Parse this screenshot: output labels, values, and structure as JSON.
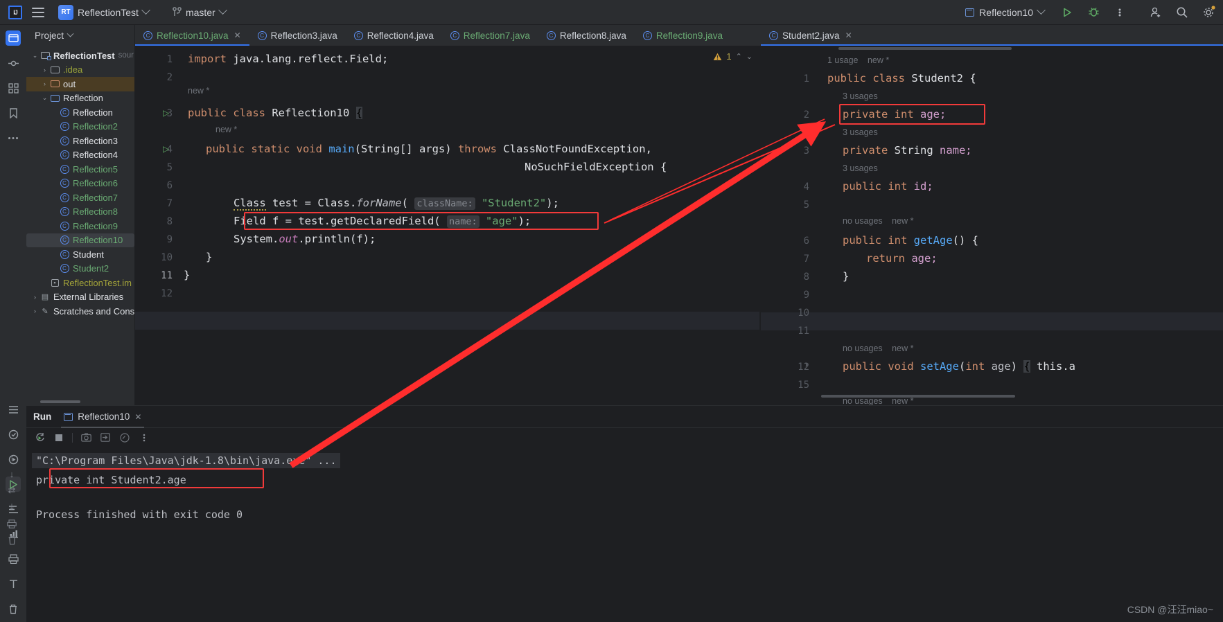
{
  "titlebar": {
    "logo": "IJ",
    "menu_icon": "hamburger-icon",
    "project_badge": "RT",
    "project_name": "ReflectionTest",
    "branch_icon": "git-branch-icon",
    "branch_name": "master",
    "run_config": "Reflection10",
    "run_icon": "run-icon",
    "debug_icon": "debug-icon",
    "more_icon": "more-vertical-icon",
    "add_user_icon": "add-user-icon",
    "search_icon": "search-icon",
    "settings_icon": "settings-icon"
  },
  "rail": {
    "items": [
      {
        "name": "project-tool-icon",
        "glyph": "▭"
      },
      {
        "name": "commit-tool-icon",
        "glyph": "⎇"
      },
      {
        "name": "structure-tool-icon",
        "glyph": "⌘"
      },
      {
        "name": "bookmarks-tool-icon",
        "glyph": "🔖"
      },
      {
        "name": "more-tool-icon",
        "glyph": "⋯"
      }
    ],
    "bottom_items": [
      {
        "name": "todo-tool-icon",
        "glyph": "☰"
      },
      {
        "name": "problems-tool-icon",
        "glyph": "◎"
      },
      {
        "name": "services-tool-icon",
        "glyph": "▶"
      },
      {
        "name": "run-tool-icon",
        "glyph": "▷"
      },
      {
        "name": "debug-console-icon",
        "glyph": "⇶"
      },
      {
        "name": "profiler-icon",
        "glyph": "📊"
      },
      {
        "name": "print-icon",
        "glyph": "🖨"
      },
      {
        "name": "terminal-tool-icon",
        "glyph": "T"
      },
      {
        "name": "delete-icon",
        "glyph": "🗑"
      }
    ]
  },
  "project_panel": {
    "title": "Project",
    "chevron": "chevron-down-icon",
    "tree": [
      {
        "depth": 0,
        "arrow": "v",
        "icon": "module-folder",
        "label": "ReflectionTest",
        "suffix": "sour",
        "style": "bold-white"
      },
      {
        "depth": 1,
        "arrow": ">",
        "icon": "folder-grey",
        "label": ".idea",
        "suffix": "",
        "style": "olive"
      },
      {
        "depth": 1,
        "arrow": ">",
        "icon": "folder-orange",
        "label": "out",
        "suffix": "",
        "style": "white",
        "selected": "out"
      },
      {
        "depth": 1,
        "arrow": "v",
        "icon": "folder-blue",
        "label": "Reflection",
        "suffix": "",
        "style": "white"
      },
      {
        "depth": 2,
        "arrow": "",
        "icon": "class",
        "label": "Reflection",
        "suffix": "",
        "style": "white"
      },
      {
        "depth": 2,
        "arrow": "",
        "icon": "class",
        "label": "Reflection2",
        "suffix": "",
        "style": "green"
      },
      {
        "depth": 2,
        "arrow": "",
        "icon": "class",
        "label": "Reflection3",
        "suffix": "",
        "style": "white"
      },
      {
        "depth": 2,
        "arrow": "",
        "icon": "class",
        "label": "Reflection4",
        "suffix": "",
        "style": "white"
      },
      {
        "depth": 2,
        "arrow": "",
        "icon": "class",
        "label": "Reflection5",
        "suffix": "",
        "style": "green"
      },
      {
        "depth": 2,
        "arrow": "",
        "icon": "class",
        "label": "Reflection6",
        "suffix": "",
        "style": "green"
      },
      {
        "depth": 2,
        "arrow": "",
        "icon": "class",
        "label": "Reflection7",
        "suffix": "",
        "style": "green"
      },
      {
        "depth": 2,
        "arrow": "",
        "icon": "class",
        "label": "Reflection8",
        "suffix": "",
        "style": "green"
      },
      {
        "depth": 2,
        "arrow": "",
        "icon": "class",
        "label": "Reflection9",
        "suffix": "",
        "style": "green"
      },
      {
        "depth": 2,
        "arrow": "",
        "icon": "class",
        "label": "Reflection10",
        "suffix": "",
        "style": "green",
        "selected": "file"
      },
      {
        "depth": 2,
        "arrow": "",
        "icon": "class",
        "label": "Student",
        "suffix": "",
        "style": "white"
      },
      {
        "depth": 2,
        "arrow": "",
        "icon": "class",
        "label": "Student2",
        "suffix": "",
        "style": "green"
      },
      {
        "depth": 1,
        "arrow": "",
        "icon": "iml",
        "label": "ReflectionTest.im",
        "suffix": "",
        "style": "yellow"
      },
      {
        "depth": 0,
        "arrow": ">",
        "icon": "library",
        "label": "External Libraries",
        "suffix": "",
        "style": "white"
      },
      {
        "depth": 0,
        "arrow": ">",
        "icon": "scratch",
        "label": "Scratches and Cons",
        "suffix": "",
        "style": "white"
      }
    ]
  },
  "editor_tabs": [
    {
      "label": "Reflection10.java",
      "active": true,
      "color": "green",
      "closable": true
    },
    {
      "label": "Reflection3.java",
      "active": false,
      "color": "white",
      "closable": false
    },
    {
      "label": "Reflection4.java",
      "active": false,
      "color": "white",
      "closable": false
    },
    {
      "label": "Reflection7.java",
      "active": false,
      "color": "green",
      "closable": false
    },
    {
      "label": "Reflection8.java",
      "active": false,
      "color": "white",
      "closable": false
    },
    {
      "label": "Reflection9.java",
      "active": false,
      "color": "green",
      "closable": false
    }
  ],
  "tabbar_overflow": "chevron-down-icon",
  "tabbar_more": "more-vertical-icon",
  "right_tab": {
    "label": "Student2.java",
    "color": "white",
    "closable": true
  },
  "left_editor": {
    "warning_count": "1",
    "warning_icon": "warning-triangle-icon",
    "up_icon": "chevron-up-icon",
    "down_icon": "chevron-down-icon",
    "line_numbers": [
      "1",
      "2",
      "3",
      "4",
      "5",
      "6",
      "7",
      "8",
      "9",
      "10",
      "11",
      "12"
    ],
    "current_line": "11",
    "inlay_hints": [
      "new *",
      "new *"
    ],
    "code": {
      "l1": "import java.lang.reflect.Field;",
      "l3": "public class Reflection10 {",
      "l4a": "public static void main(String[] args) throws ClassNotFoundException,",
      "l5": "NoSuchFieldException {",
      "l7": "Class test = Class.forName( className: \"Student2\");",
      "l7_parts": {
        "t1": "Class",
        "t2": " test = Class.",
        "t3": "forName",
        "t4": "( ",
        "hint": "className:",
        "str": "\"Student2\"",
        "t5": ");"
      },
      "l8": "Field f = test.getDeclaredField( name: \"age\");",
      "l8_parts": {
        "t1": "Field",
        "t2": " f = test.getDeclaredField",
        "t3": "( ",
        "hint": "name:",
        "str": "\"age\"",
        "t4": ");"
      },
      "l9": "System.out.println(f);",
      "l10": "}",
      "l11": "}"
    }
  },
  "right_editor": {
    "line_numbers": [
      "1",
      "2",
      "3",
      "4",
      "5",
      "6",
      "7",
      "8",
      "9",
      "10",
      "11",
      "12",
      "15"
    ],
    "lines": [
      {
        "usage": "1 usage",
        "new": "new *",
        "code": "public class Student2 {",
        "num": "1"
      },
      {
        "usage": "3 usages",
        "new": "",
        "code": "private int age;",
        "num": "2",
        "boxed": true
      },
      {
        "usage": "3 usages",
        "new": "",
        "code": "private String name;",
        "num": "3"
      },
      {
        "usage": "3 usages",
        "new": "",
        "code": "public int id;",
        "num": "4"
      },
      {
        "usage": "",
        "new": "",
        "code": "",
        "num": "5"
      },
      {
        "usage": "no usages",
        "new": "new *",
        "code": "public int getAge() {",
        "num": "6"
      },
      {
        "usage": "",
        "new": "",
        "code": "return age;",
        "num": "7"
      },
      {
        "usage": "",
        "new": "",
        "code": "}",
        "num": "8"
      },
      {
        "usage": "",
        "new": "",
        "code": "",
        "num": "9"
      },
      {
        "usage": "",
        "new": "",
        "code": "",
        "num": "10"
      },
      {
        "usage": "",
        "new": "",
        "code": "",
        "num": "11"
      },
      {
        "usage": "no usages",
        "new": "new *",
        "code": "public void setAge(int age) { this.a",
        "num": "12"
      },
      {
        "usage": "no usages",
        "new": "new *",
        "code": "",
        "num": "15"
      }
    ]
  },
  "run_window": {
    "title": "Run",
    "tab_label": "Reflection10",
    "tab_icon": "run-config-icon",
    "close_icon": "close-icon",
    "toolbar": [
      {
        "name": "rerun-icon",
        "glyph": "⟳"
      },
      {
        "name": "stop-icon",
        "glyph": "■"
      },
      {
        "name": "screenshot-icon",
        "glyph": "⎙"
      },
      {
        "name": "export-icon",
        "glyph": "⇥"
      },
      {
        "name": "soft-wrap-icon",
        "glyph": "⊘"
      },
      {
        "name": "more-vertical-icon",
        "glyph": "⋮"
      }
    ],
    "side_icons": [
      {
        "name": "scroll-up-icon",
        "glyph": "↑"
      },
      {
        "name": "scroll-down-icon",
        "glyph": "↓"
      },
      {
        "name": "soft-wrap-toggle-icon",
        "glyph": "⇄"
      },
      {
        "name": "scroll-end-icon",
        "glyph": "⤓"
      },
      {
        "name": "print-icon",
        "glyph": "🖨"
      },
      {
        "name": "clear-all-icon",
        "glyph": "🗑"
      }
    ],
    "console": [
      "\"C:\\Program Files\\Java\\jdk-1.8\\bin\\java.exe\" ...",
      "private int Student2.age",
      "",
      "Process finished with exit code 0"
    ],
    "command_line": "\"C:\\Program Files\\Java\\jdk-1.8\\bin\\java.exe\" ...",
    "output_line": "private int Student2.age",
    "exit_line": "Process finished with exit code 0"
  },
  "watermark": "CSDN @汪汪miao~",
  "colors": {
    "accent": "#3574f0",
    "annotation_red": "#f23a3a",
    "bg": "#1e1f22",
    "panel": "#2b2d30",
    "string_green": "#6aab73",
    "keyword_orange": "#cf8e6d"
  }
}
